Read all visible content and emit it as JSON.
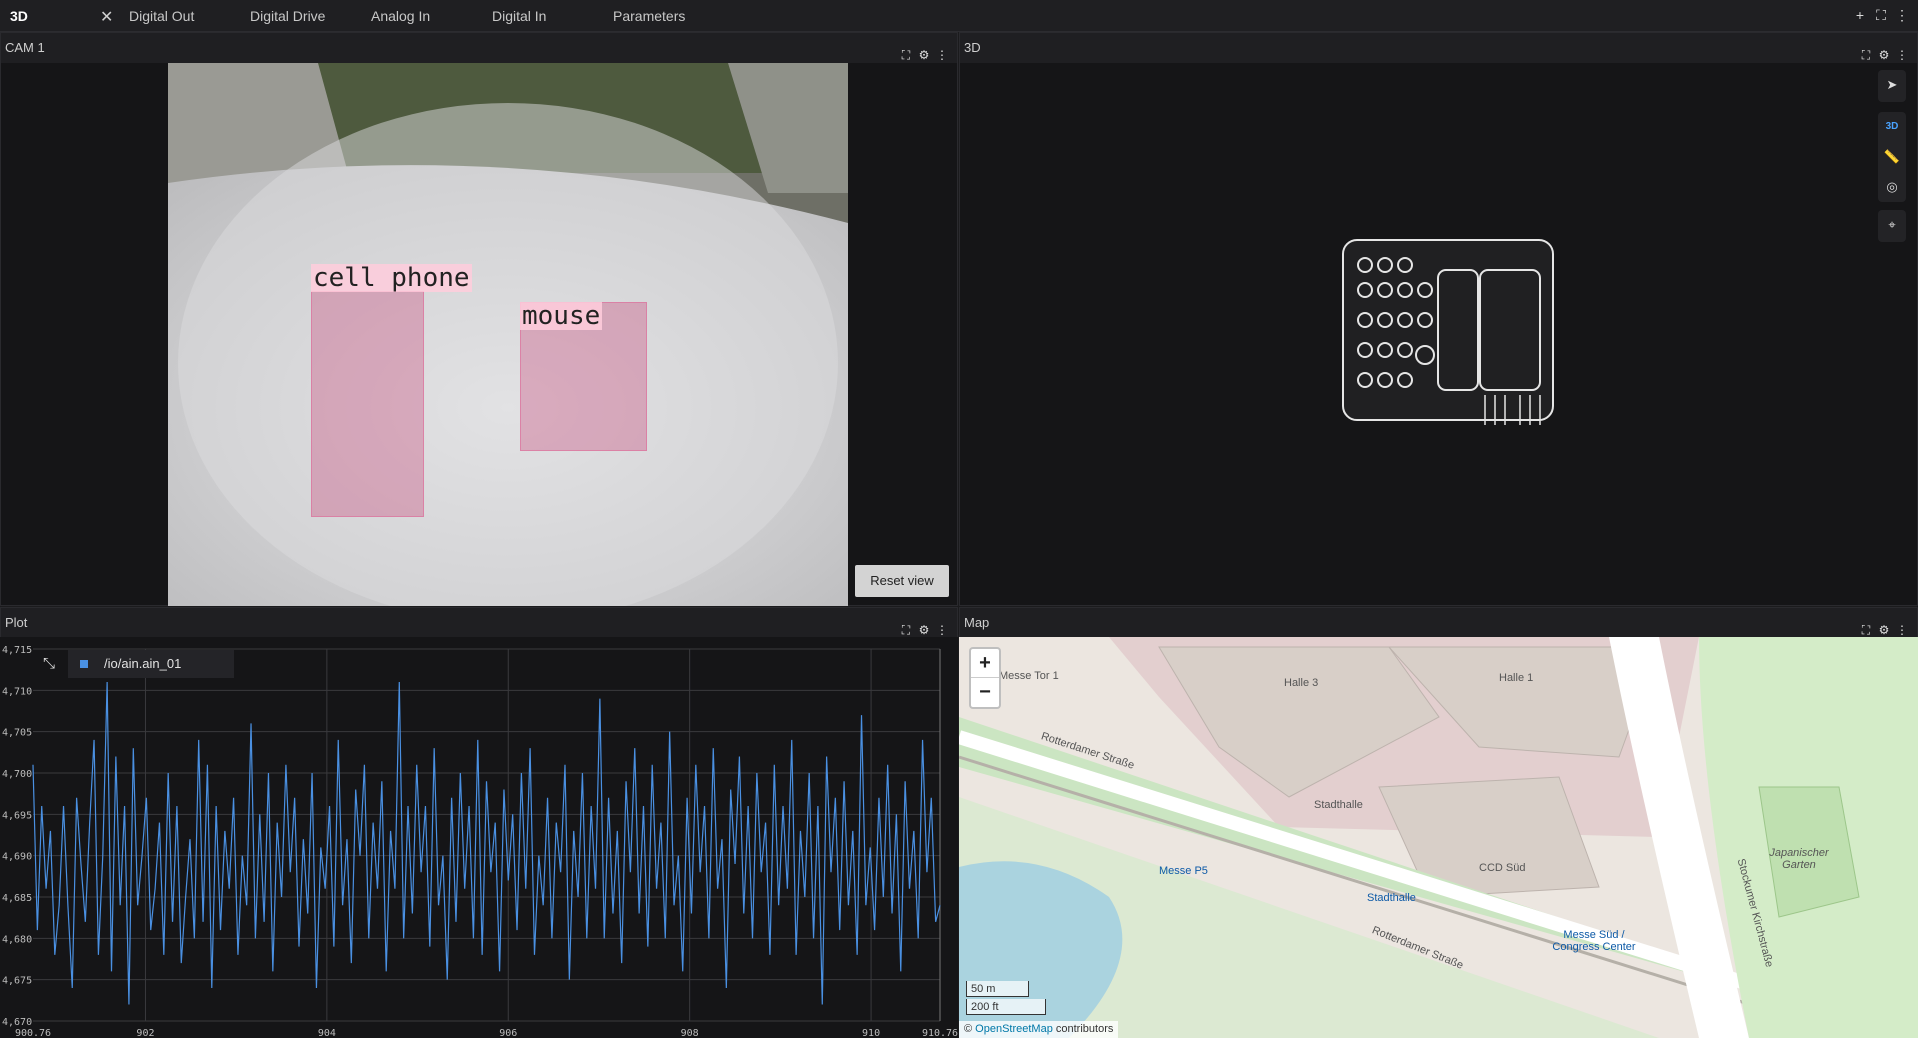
{
  "tabs": {
    "active": "3D",
    "items": [
      "Digital Out",
      "Digital Drive",
      "Analog In",
      "Digital In",
      "Parameters"
    ]
  },
  "cam_panel": {
    "title": "CAM 1",
    "detections": [
      {
        "label": "cell phone"
      },
      {
        "label": "mouse"
      }
    ],
    "reset_label": "Reset view"
  },
  "panel3d": {
    "title": "3D",
    "tools": {
      "mode_label": "3D"
    }
  },
  "plot_panel": {
    "title": "Plot",
    "legend": "/io/ain.ain_01"
  },
  "chart_data": {
    "type": "line",
    "x_ticks": [
      "900.76",
      "902",
      "904",
      "906",
      "908",
      "910",
      "910.76"
    ],
    "y_ticks": [
      "4,715",
      "4,710",
      "4,705",
      "4,700",
      "4,695",
      "4,690",
      "4,685",
      "4,680",
      "4,675",
      "4,670"
    ],
    "xlim": [
      900.76,
      910.76
    ],
    "ylim": [
      4.67,
      4.715
    ],
    "grid": true,
    "color": "#4a90e2",
    "series": [
      {
        "name": "/io/ain.ain_01",
        "y": [
          4.701,
          4.681,
          4.696,
          4.686,
          4.693,
          4.678,
          4.684,
          4.696,
          4.684,
          4.674,
          4.697,
          4.689,
          4.682,
          4.694,
          4.704,
          4.678,
          4.69,
          4.711,
          4.676,
          4.702,
          4.684,
          4.696,
          4.672,
          4.703,
          4.684,
          4.69,
          4.697,
          4.681,
          4.686,
          4.694,
          4.678,
          4.7,
          4.682,
          4.696,
          4.677,
          4.685,
          4.692,
          4.68,
          4.704,
          4.682,
          4.701,
          4.674,
          4.696,
          4.681,
          4.693,
          4.686,
          4.697,
          4.678,
          4.69,
          4.684,
          4.706,
          4.68,
          4.695,
          4.682,
          4.7,
          4.676,
          4.694,
          4.685,
          4.701,
          4.688,
          4.697,
          4.679,
          4.692,
          4.683,
          4.7,
          4.674,
          4.691,
          4.686,
          4.696,
          4.679,
          4.704,
          4.684,
          4.692,
          4.677,
          4.698,
          4.69,
          4.701,
          4.68,
          4.694,
          4.686,
          4.699,
          4.676,
          4.693,
          4.686,
          4.711,
          4.68,
          4.696,
          4.683,
          4.701,
          4.688,
          4.696,
          4.679,
          4.703,
          4.684,
          4.69,
          4.675,
          4.697,
          4.682,
          4.7,
          4.686,
          4.696,
          4.68,
          4.704,
          4.678,
          4.699,
          4.688,
          4.694,
          4.676,
          4.698,
          4.687,
          4.695,
          4.681,
          4.7,
          4.686,
          4.703,
          4.678,
          4.69,
          4.684,
          4.697,
          4.68,
          4.694,
          4.688,
          4.701,
          4.675,
          4.693,
          4.685,
          4.7,
          4.68,
          4.696,
          4.686,
          4.709,
          4.68,
          4.697,
          4.683,
          4.693,
          4.677,
          4.699,
          4.688,
          4.703,
          4.683,
          4.696,
          4.679,
          4.701,
          4.686,
          4.694,
          4.68,
          4.705,
          4.684,
          4.69,
          4.676,
          4.697,
          4.683,
          4.701,
          4.688,
          4.696,
          4.68,
          4.703,
          4.686,
          4.692,
          4.674,
          4.698,
          4.689,
          4.702,
          4.683,
          4.696,
          4.68,
          4.7,
          4.688,
          4.694,
          4.678,
          4.701,
          4.684,
          4.696,
          4.686,
          4.704,
          4.678,
          4.693,
          4.685,
          4.7,
          4.68,
          4.696,
          4.672,
          4.702,
          4.688,
          4.697,
          4.681,
          4.699,
          4.684,
          4.693,
          4.678,
          4.707,
          4.684,
          4.691,
          4.681,
          4.697,
          4.685,
          4.701,
          4.683,
          4.695,
          4.676,
          4.699,
          4.686,
          4.693,
          4.68,
          4.704,
          4.688,
          4.697,
          4.682,
          4.684
        ]
      }
    ]
  },
  "map_panel": {
    "title": "Map",
    "zoom_in": "+",
    "zoom_out": "−",
    "scale_m": "50 m",
    "scale_ft": "200 ft",
    "attribution_prefix": "©",
    "attribution_link": "OpenStreetMap",
    "attribution_suffix": "contributors",
    "labels": {
      "messe_tor": "Messe Tor 1",
      "halle3": "Halle 3",
      "halle1": "Halle 1",
      "rotterdamer1": "Rotterdamer Straße",
      "rotterdamer2": "Rotterdamer Straße",
      "stadthalle": "Stadthalle",
      "stadthalle_stop": "Stadthalle",
      "ccd_sud": "CCD Süd",
      "messe_p5": "Messe P5",
      "messe_sud": "Messe Süd / Congress Center",
      "stockumer": "Stockumer Kirchstraße",
      "japanischer": "Japanischer Garten"
    }
  }
}
